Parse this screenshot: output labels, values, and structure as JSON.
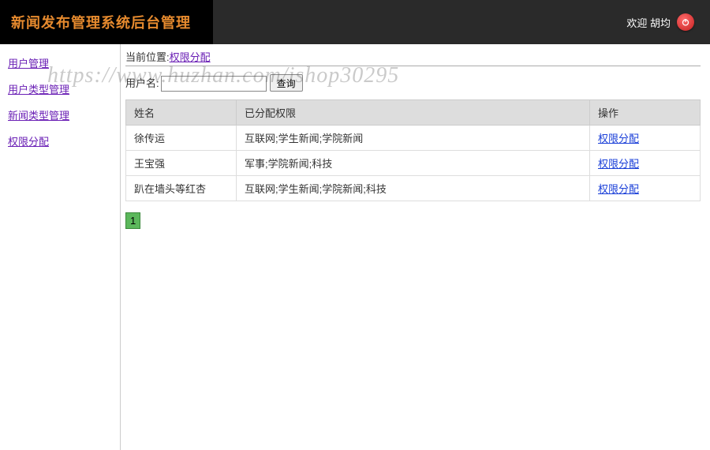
{
  "header": {
    "title": "新闻发布管理系统后台管理",
    "welcome_prefix": "欢迎",
    "username": "胡均"
  },
  "sidebar": {
    "items": [
      {
        "label": "用户管理"
      },
      {
        "label": "用户类型管理"
      },
      {
        "label": "新闻类型管理"
      },
      {
        "label": "权限分配"
      }
    ]
  },
  "breadcrumb": {
    "prefix": "当前位置:",
    "current": "权限分配"
  },
  "search": {
    "label": "用户名:",
    "value": "",
    "button": "查询"
  },
  "table": {
    "headers": {
      "name": "姓名",
      "perms": "已分配权限",
      "action": "操作"
    },
    "rows": [
      {
        "name": "徐传运",
        "perms": "互联网;学生新闻;学院新闻",
        "action": "权限分配"
      },
      {
        "name": "王宝强",
        "perms": "军事;学院新闻;科技",
        "action": "权限分配"
      },
      {
        "name": "趴在墙头等红杏",
        "perms": "互联网;学生新闻;学院新闻;科技",
        "action": "权限分配"
      }
    ]
  },
  "pagination": {
    "current": "1"
  },
  "watermark": "https://www.huzhan.com/ishop30295"
}
